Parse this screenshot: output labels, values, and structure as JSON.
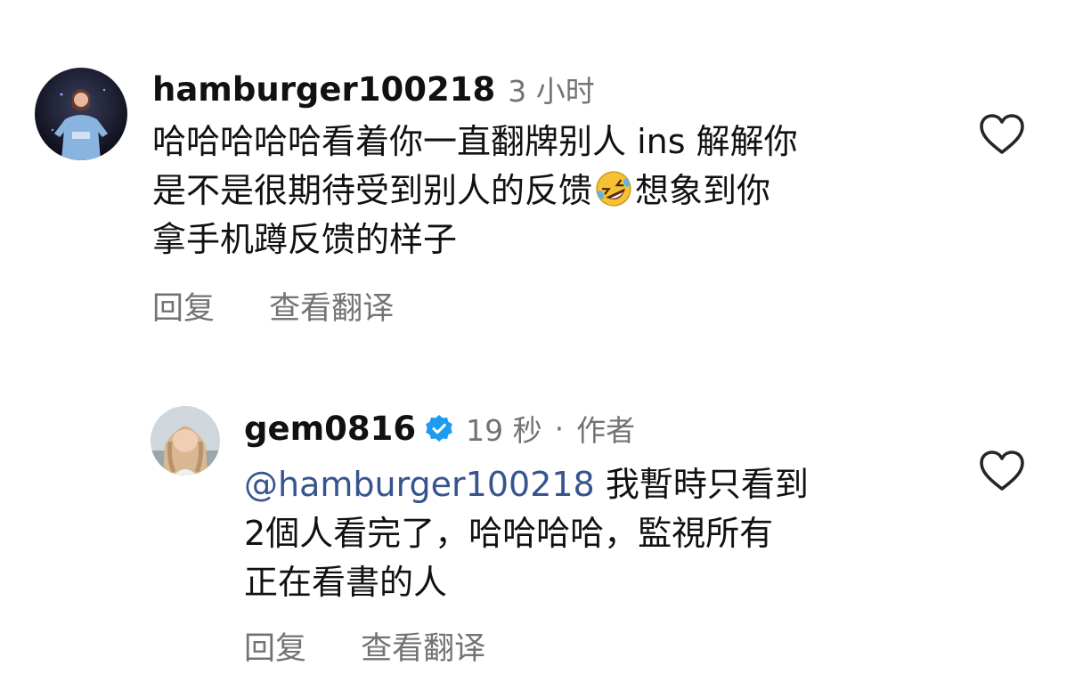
{
  "comments": [
    {
      "username": "hamburger100218",
      "time": "3 小时",
      "text_lines": [
        "哈哈哈哈哈看着你一直翻牌别人 ins 解解你",
        "是不是很期待受到别人的反馈",
        "想象到你",
        "拿手机蹲反馈的样子"
      ],
      "emoji": "rolling-on-the-floor-laughing-emoji",
      "reply_label": "回复",
      "translate_label": "查看翻译"
    },
    {
      "username": "gem0816",
      "verified": true,
      "time": "19 秒",
      "separator": "·",
      "author_tag": "作者",
      "mention": "@hamburger100218",
      "text_lines": [
        " 我暫時只看到",
        "2個人看完了，哈哈哈哈，監視所有",
        "正在看書的人"
      ],
      "reply_label": "回复",
      "translate_label": "查看翻译"
    }
  ],
  "colors": {
    "text": "#111111",
    "muted": "#737373",
    "mention": "#37548f",
    "verified": "#1d9bf0",
    "heart": "#262626"
  },
  "icons": {
    "like": "heart-outline-icon",
    "verified": "verified-badge-icon"
  }
}
